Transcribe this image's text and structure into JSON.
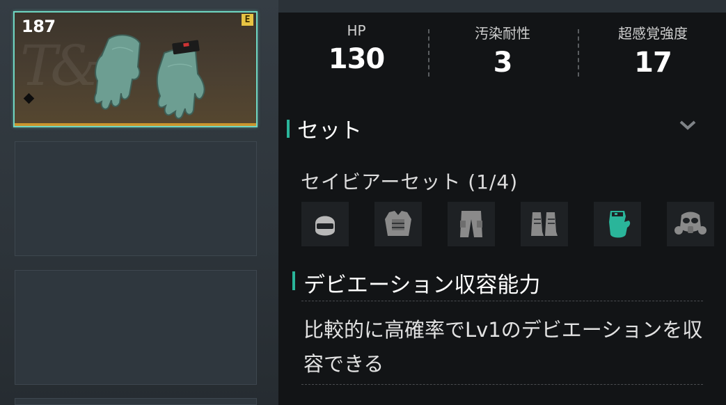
{
  "item": {
    "level": "187",
    "grade": "E",
    "brand_watermark": "T&C"
  },
  "stats": [
    {
      "label": "HP",
      "value": "130"
    },
    {
      "label": "汚染耐性",
      "value": "3"
    },
    {
      "label": "超感覚強度",
      "value": "17"
    }
  ],
  "set_section": {
    "title": "セット",
    "set_name": "セイビアーセット (1/4)",
    "pieces": [
      {
        "icon": "helmet-icon",
        "owned": false
      },
      {
        "icon": "vest-icon",
        "owned": false
      },
      {
        "icon": "pants-icon",
        "owned": false
      },
      {
        "icon": "boots-icon",
        "owned": false
      },
      {
        "icon": "glove-icon",
        "owned": true
      },
      {
        "icon": "gas-mask-icon",
        "owned": false
      }
    ]
  },
  "ability_section": {
    "title": "デビエーション収容能力",
    "description": "比較的に高確率でLv1のデビエーションを収容できる"
  },
  "colors": {
    "accent": "#2ab59a",
    "selected_border": "#6fd6c2",
    "rarity": "#c9952e",
    "grade_badge": "#e7c443"
  }
}
